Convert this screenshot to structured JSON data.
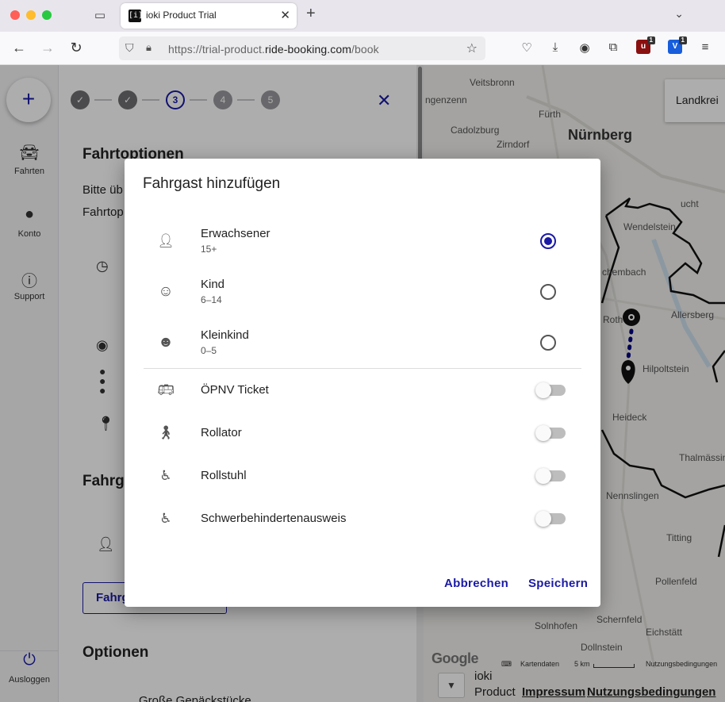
{
  "browser": {
    "tab_title": "ioki Product Trial",
    "tab_favicon": "[i]",
    "url_prefix": "https://trial-product.",
    "url_host": "ride-booking.com",
    "url_path": "/book",
    "extension_badges": [
      "1",
      "1"
    ]
  },
  "sidebar": {
    "new_ride_icon": "+",
    "items": [
      {
        "label": "Fahrten",
        "icon": "car-icon"
      },
      {
        "label": "Konto",
        "icon": "account-icon"
      },
      {
        "label": "Support",
        "icon": "info-icon"
      }
    ],
    "logout_label": "Ausloggen"
  },
  "stepper": {
    "steps": [
      "✓",
      "✓",
      "3",
      "4",
      "5"
    ],
    "active_step": 3
  },
  "content": {
    "heading_ride_options": "Fahrtoptionen",
    "text_line1": "Bitte üb",
    "text_line2": "Fahrtop",
    "heading_passengers": "Fahrg",
    "passengers_button": "Fahrg",
    "heading_options": "Optionen",
    "bottom_text": "Große Gepäckstücke"
  },
  "map": {
    "landkreis_label": "Landkrei",
    "city": "Nürnberg",
    "places": [
      "Veitsbronn",
      "ngenzenn",
      "Fürth",
      "Cadolzburg",
      "Zirndorf",
      "Wendelstein",
      "chembach",
      "Roth",
      "Allersberg",
      "Hilpoltstein",
      "Heideck",
      "Thalmässing",
      "Nennslingen",
      "Titting",
      "Pollenfeld",
      "Schernfeld",
      "Solnhofen",
      "Eichstätt",
      "Dollnstein",
      "ucht"
    ],
    "attribution_data": "Kartendaten",
    "scale_label": "5 km",
    "attribution_terms": "Nutzungsbedingungen",
    "google": "Google"
  },
  "footer": {
    "company": "ioki",
    "product": "Product",
    "impressum": "Impressum",
    "nutzung": "Nutzungsbedingungen"
  },
  "dialog": {
    "title": "Fahrgast hinzufügen",
    "passenger_types": [
      {
        "label": "Erwachsener",
        "age": "15+",
        "icon": "person-icon",
        "selected": true
      },
      {
        "label": "Kind",
        "age": "6–14",
        "icon": "child-face-icon",
        "selected": false
      },
      {
        "label": "Kleinkind",
        "age": "0–5",
        "icon": "baby-face-icon",
        "selected": false
      }
    ],
    "options": [
      {
        "label": "ÖPNV Ticket",
        "icon": "ticket-icon",
        "enabled": false
      },
      {
        "label": "Rollator",
        "icon": "walker-icon",
        "enabled": false
      },
      {
        "label": "Rollstuhl",
        "icon": "wheelchair-icon",
        "enabled": false
      },
      {
        "label": "Schwerbehindertenausweis",
        "icon": "accessible-card-icon",
        "enabled": false
      }
    ],
    "cancel_label": "Abbrechen",
    "save_label": "Speichern"
  },
  "colors": {
    "accent": "#1a1aa6",
    "route": "#000080"
  }
}
